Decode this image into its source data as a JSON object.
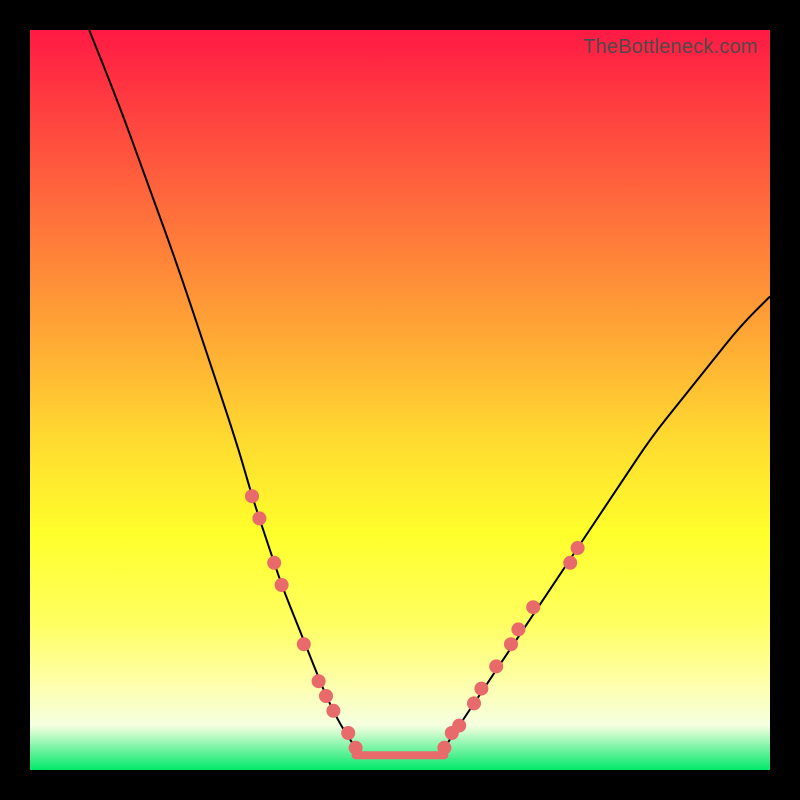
{
  "attribution": "TheBottleneck.com",
  "colors": {
    "gradient_top": "#ff1a44",
    "gradient_bottom": "#00e96a",
    "curve": "#000000",
    "marker": "#e96a6a",
    "frame": "#000000"
  },
  "chart_data": {
    "type": "line",
    "title": "",
    "xlabel": "",
    "ylabel": "",
    "xlim": [
      0,
      100
    ],
    "ylim": [
      0,
      100
    ],
    "series": [
      {
        "name": "left-curve",
        "x": [
          8,
          12,
          16,
          20,
          24,
          28,
          30,
          32,
          34,
          36,
          38,
          40,
          42,
          44
        ],
        "y": [
          100,
          90,
          79,
          68,
          56,
          44,
          37,
          31,
          25,
          20,
          15,
          10,
          6,
          3
        ]
      },
      {
        "name": "right-curve",
        "x": [
          56,
          58,
          60,
          62,
          64,
          68,
          72,
          76,
          80,
          84,
          88,
          92,
          96,
          100
        ],
        "y": [
          3,
          6,
          9,
          12,
          15,
          21,
          27,
          33,
          39,
          45,
          50,
          55,
          60,
          64
        ]
      },
      {
        "name": "flat-bottom",
        "x": [
          44,
          56
        ],
        "y": [
          2,
          2
        ]
      }
    ],
    "markers": [
      {
        "x": 30,
        "y": 37
      },
      {
        "x": 31,
        "y": 34
      },
      {
        "x": 33,
        "y": 28
      },
      {
        "x": 34,
        "y": 25
      },
      {
        "x": 37,
        "y": 17
      },
      {
        "x": 39,
        "y": 12
      },
      {
        "x": 40,
        "y": 10
      },
      {
        "x": 41,
        "y": 8
      },
      {
        "x": 43,
        "y": 5
      },
      {
        "x": 44,
        "y": 3
      },
      {
        "x": 56,
        "y": 3
      },
      {
        "x": 57,
        "y": 5
      },
      {
        "x": 58,
        "y": 6
      },
      {
        "x": 60,
        "y": 9
      },
      {
        "x": 61,
        "y": 11
      },
      {
        "x": 63,
        "y": 14
      },
      {
        "x": 65,
        "y": 17
      },
      {
        "x": 66,
        "y": 19
      },
      {
        "x": 68,
        "y": 22
      },
      {
        "x": 73,
        "y": 28
      },
      {
        "x": 74,
        "y": 30
      }
    ],
    "flat_segment": {
      "x0": 44,
      "x1": 56,
      "y": 2
    }
  }
}
